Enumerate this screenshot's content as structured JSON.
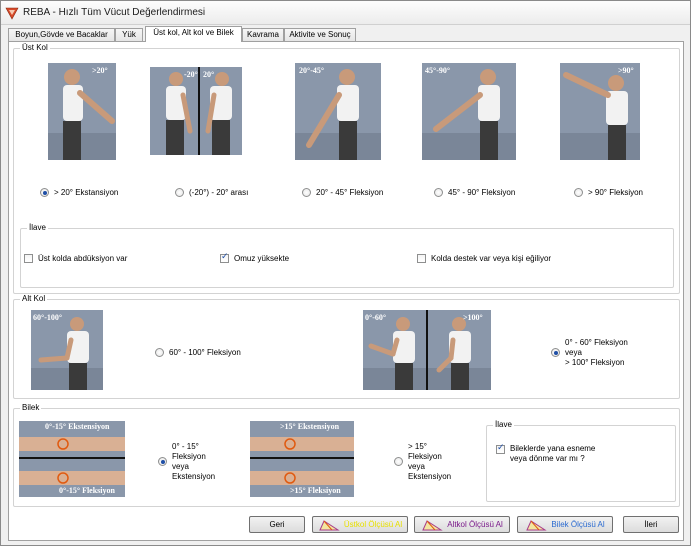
{
  "window": {
    "title": "REBA - Hızlı Tüm Vücut Değerlendirmesi"
  },
  "tabs": [
    {
      "label": "Boyun,Gövde ve Bacaklar",
      "active": false
    },
    {
      "label": "Yük",
      "active": false
    },
    {
      "label": "Üst kol, Alt kol ve Bilek",
      "active": true
    },
    {
      "label": "Kavrama",
      "active": false
    },
    {
      "label": "Aktivite ve Sonuç",
      "active": false
    }
  ],
  "upper_arm": {
    "legend": "Üst Kol",
    "images": [
      {
        "overlay": ">20°",
        "icon": "upper-arm-extension"
      },
      {
        "overlay_left": "-20°",
        "overlay_right": "20°",
        "icon": "upper-arm-neutral"
      },
      {
        "overlay": "20°-45°",
        "icon": "upper-arm-flexion-20-45"
      },
      {
        "overlay": "45°-90°",
        "icon": "upper-arm-flexion-45-90"
      },
      {
        "overlay": ">90°",
        "icon": "upper-arm-flexion-90"
      }
    ],
    "options": [
      {
        "label": "> 20° Ekstansiyon",
        "checked": true
      },
      {
        "label": "(-20°) - 20° arası",
        "checked": false
      },
      {
        "label": "20° - 45° Fleksiyon",
        "checked": false
      },
      {
        "label": "45° - 90° Fleksiyon",
        "checked": false
      },
      {
        "label": "> 90° Fleksiyon",
        "checked": false
      }
    ],
    "extra": {
      "legend": "İlave",
      "options": [
        {
          "label": "Üst kolda abdüksiyon var",
          "checked": false
        },
        {
          "label": "Omuz yüksekte",
          "checked": true
        },
        {
          "label": "Kolda destek var veya kişi eğiliyor",
          "checked": false
        }
      ]
    }
  },
  "lower_arm": {
    "legend": "Alt Kol",
    "images": [
      {
        "overlay": "60°-100°",
        "icon": "lower-arm-60-100"
      },
      {
        "overlay_left": "0°-60°",
        "overlay_right": ">100°",
        "icon": "lower-arm-other"
      }
    ],
    "options": [
      {
        "label": "60° - 100° Fleksiyon",
        "checked": false
      },
      {
        "lines": [
          "0° - 60° Fleksiyon",
          "veya",
          "> 100° Fleksiyon"
        ],
        "checked": true
      }
    ]
  },
  "wrist": {
    "legend": "Bilek",
    "images": [
      {
        "overlay_top": "0°-15° Ekstensiyon",
        "overlay_bottom": "0°-15° Fleksiyon",
        "icon": "wrist-0-15"
      },
      {
        "overlay_top": ">15° Ekstensiyon",
        "overlay_bottom": ">15° Fleksiyon",
        "icon": "wrist-over-15"
      }
    ],
    "options": [
      {
        "lines": [
          "0° - 15°",
          "Fleksiyon",
          "veya",
          "Ekstensiyon"
        ],
        "checked": true
      },
      {
        "lines": [
          "> 15°",
          "Fleksiyon",
          "veya",
          "Ekstensiyon"
        ],
        "checked": false
      }
    ],
    "extra": {
      "legend": "İlave",
      "option": {
        "lines": [
          "Bileklerde yana esneme",
          "veya dönme var mı ?"
        ],
        "checked": true
      }
    }
  },
  "buttons": {
    "back": "Geri",
    "upper_arm_measure": "Üstkol Ölçüsü Al",
    "lower_arm_measure": "Altkol Ölçüsü Al",
    "wrist_measure": "Bilek Ölçüsü Al",
    "next": "İleri"
  },
  "colors": {
    "accent_check": "#1f4fa6",
    "upper_arm_button_text": "#e8e000",
    "lower_arm_button_text": "#7a1a8a",
    "wrist_button_text": "#2a6ad0",
    "app_icon": "#d84a2a"
  }
}
